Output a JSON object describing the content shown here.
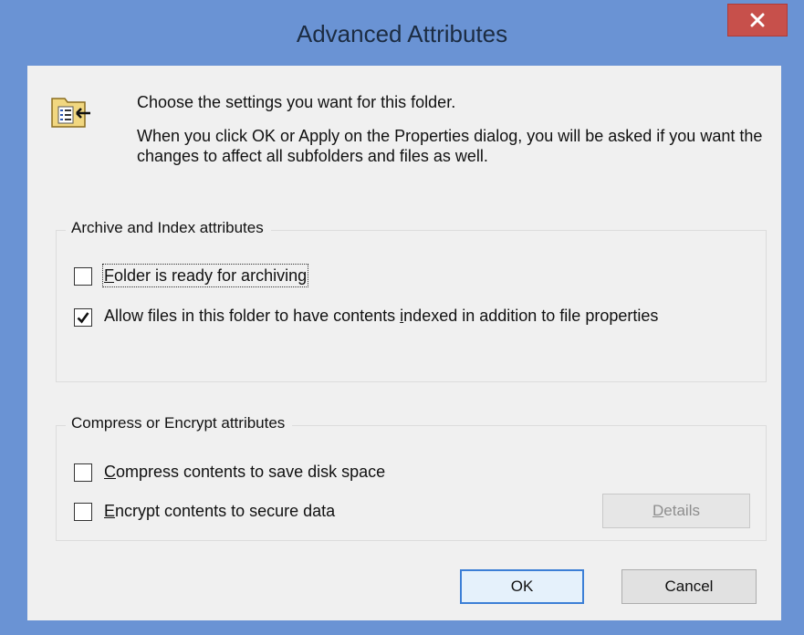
{
  "window": {
    "title": "Advanced Attributes",
    "close_icon": "close-icon",
    "accent_color": "#6a93d4",
    "close_color": "#c7504b"
  },
  "intro": {
    "icon": "folder-attributes-icon",
    "line1": "Choose the settings you want for this folder.",
    "line2": "When you click OK or Apply on the Properties dialog, you will be asked if you want the changes to affect all subfolders and files as well."
  },
  "archive_group": {
    "label": "Archive and Index attributes",
    "archiving": {
      "label_pre": "",
      "label_mnemonic": "F",
      "label_post": "older is ready for archiving",
      "checked": false
    },
    "indexing": {
      "label_pre": "Allow files in this folder to have contents ",
      "label_mnemonic": "i",
      "label_post": "ndexed in addition to file properties",
      "checked": true
    }
  },
  "compress_group": {
    "label": "Compress or Encrypt attributes",
    "compress": {
      "label_pre": "",
      "label_mnemonic": "C",
      "label_post": "ompress contents to save disk space",
      "checked": false
    },
    "encrypt": {
      "label_pre": "",
      "label_mnemonic": "E",
      "label_post": "ncrypt contents to secure data",
      "checked": false
    },
    "details_pre": "",
    "details_mnemonic": "D",
    "details_post": "etails"
  },
  "buttons": {
    "ok": "OK",
    "cancel": "Cancel"
  }
}
